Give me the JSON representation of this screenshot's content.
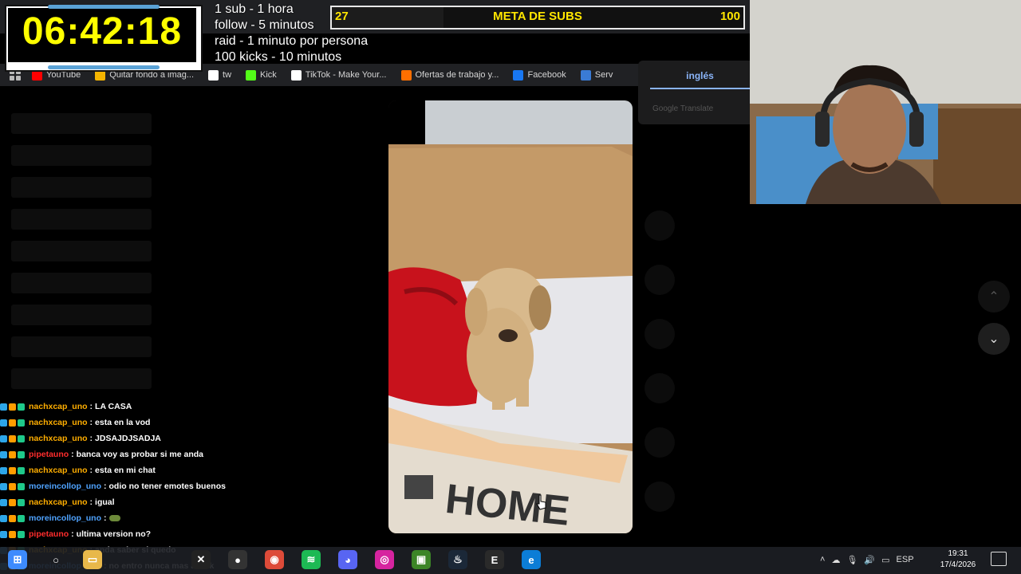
{
  "timer": {
    "value": "06:42:18"
  },
  "rules": [
    "1 sub - 1 hora",
    "follow - 5 minutos",
    "raid - 1 minuto por persona",
    "100 kicks - 10 minutos"
  ],
  "subs_goal": {
    "title": "META DE SUBS",
    "current": "27",
    "goal": "100",
    "progress": 0.27
  },
  "bookmarks": [
    {
      "label": "YouTube",
      "icon": "youtube-icon",
      "color": "#ff0000"
    },
    {
      "label": "Quitar fondo a imag...",
      "icon": "image-icon",
      "color": "#f4b400"
    },
    {
      "label": "tw",
      "icon": "x-icon",
      "color": "#ffffff"
    },
    {
      "label": "Kick",
      "icon": "kick-icon",
      "color": "#53fc18"
    },
    {
      "label": "TikTok - Make Your...",
      "icon": "tiktok-icon",
      "color": "#ffffff"
    },
    {
      "label": "Ofertas de trabajo y...",
      "icon": "job-icon",
      "color": "#ff6f00"
    },
    {
      "label": "Facebook",
      "icon": "facebook-icon",
      "color": "#1877f2"
    },
    {
      "label": "Serv",
      "icon": "server-icon",
      "color": "#3a7bd5"
    }
  ],
  "translate": {
    "tab": "inglés",
    "credit": "Google Translate"
  },
  "chat": [
    {
      "user": "nachxcap_uno",
      "user_color": "#ffae00",
      "text": "LA CASA"
    },
    {
      "user": "nachxcap_uno",
      "user_color": "#ffae00",
      "text": "esta en la vod"
    },
    {
      "user": "nachxcap_uno",
      "user_color": "#ffae00",
      "text": "JDSAJDJSADJA"
    },
    {
      "user": "pipetauno",
      "user_color": "#ff2d2d",
      "text": "banca voy as probar si me anda"
    },
    {
      "user": "nachxcap_uno",
      "user_color": "#ffae00",
      "text": "esta en mi chat"
    },
    {
      "user": "moreincollop_uno",
      "user_color": "#4fa3ff",
      "text": "odio no tener emotes buenos"
    },
    {
      "user": "nachxcap_uno",
      "user_color": "#ffae00",
      "text": "igual"
    },
    {
      "user": "moreincollop_uno",
      "user_color": "#4fa3ff",
      "text": ""
    },
    {
      "user": "pipetauno",
      "user_color": "#ff2d2d",
      "text": "ultima version no?"
    },
    {
      "user": "nachxcap_uno",
      "user_color": "#ffae00",
      "text": "anda saber si quedo"
    },
    {
      "user": "moreincollop_uno",
      "user_color": "#4fa3ff",
      "text": "no entro nunca mas a kick"
    }
  ],
  "taskbar": {
    "apps": [
      {
        "name": "windows-start-icon",
        "color": "#3d8bfd",
        "glyph": "⊞"
      },
      {
        "name": "search-icon",
        "color": "transparent",
        "glyph": "○"
      },
      {
        "name": "file-explorer-icon",
        "color": "#e8b84a",
        "glyph": "▭"
      },
      {
        "name": "capcut-icon",
        "color": "#222",
        "glyph": "✕"
      },
      {
        "name": "obs-icon",
        "color": "#333",
        "glyph": "●"
      },
      {
        "name": "chrome-icon",
        "color": "#dd4b39",
        "glyph": "◉"
      },
      {
        "name": "spotify-icon",
        "color": "#1db954",
        "glyph": "≋"
      },
      {
        "name": "discord-icon",
        "color": "#5865f2",
        "glyph": "◕"
      },
      {
        "name": "instagram-icon",
        "color": "#d6249f",
        "glyph": "◎"
      },
      {
        "name": "minecraft-icon",
        "color": "#3c8527",
        "glyph": "▣"
      },
      {
        "name": "steam-icon",
        "color": "#1b2838",
        "glyph": "♨"
      },
      {
        "name": "epic-games-icon",
        "color": "#2a2a2a",
        "glyph": "E"
      },
      {
        "name": "edge-icon",
        "color": "#0c7dd6",
        "glyph": "e"
      }
    ],
    "language": "ESP",
    "time": "19:31",
    "date": "17/4/2026"
  }
}
